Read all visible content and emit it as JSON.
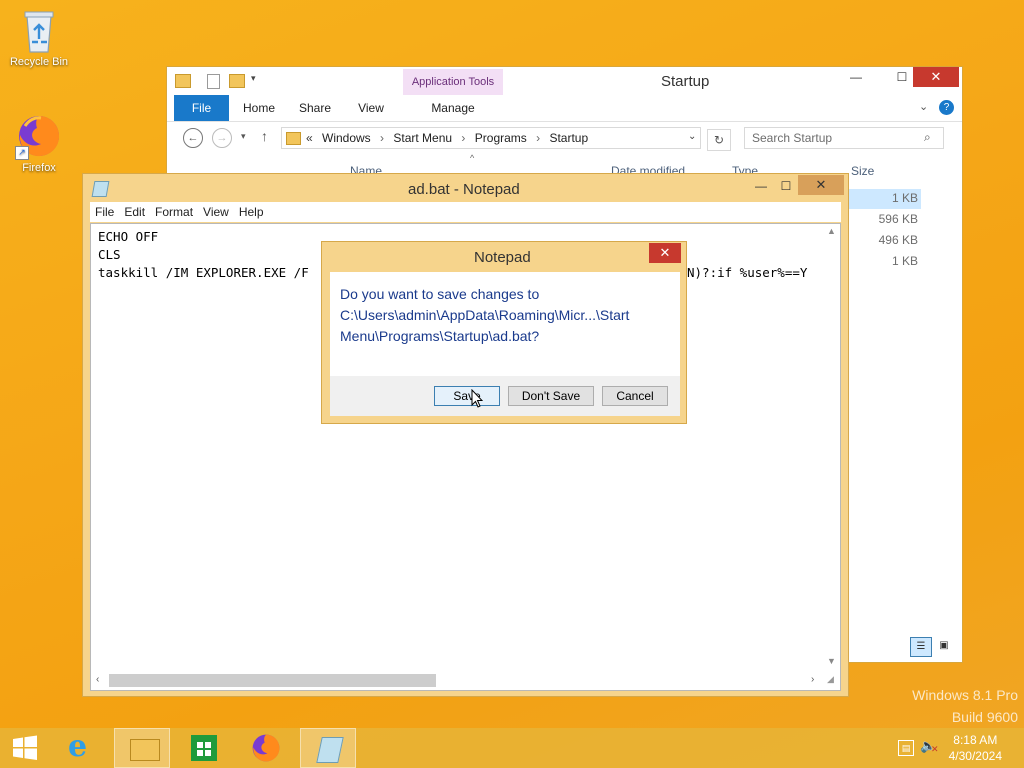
{
  "desktop": {
    "icons": [
      {
        "label": "Recycle Bin"
      },
      {
        "label": "Firefox"
      }
    ],
    "watermark_line1": "Windows 8.1 Pro",
    "watermark_line2": "Build 9600"
  },
  "explorer": {
    "title": "Startup",
    "context_tab": "Application Tools",
    "tabs": [
      "File",
      "Home",
      "Share",
      "View",
      "Manage"
    ],
    "breadcrumb_prefix": "«",
    "breadcrumb": [
      "Windows",
      "Start Menu",
      "Programs",
      "Startup"
    ],
    "search_placeholder": "Search Startup",
    "columns": {
      "name": "Name",
      "date": "Date modified",
      "type": "Type",
      "size": "Size"
    },
    "sizes": [
      "1 KB",
      "596 KB",
      "496 KB",
      "1 KB"
    ]
  },
  "notepad": {
    "title": "ad.bat - Notepad",
    "menu": [
      "File",
      "Edit",
      "Format",
      "View",
      "Help"
    ],
    "lines": [
      "ECHO OFF",
      "CLS",
      "taskkill /IM EXPLORER.EXE /F",
      "N)?:if %user%==Y"
    ]
  },
  "dialog": {
    "title": "Notepad",
    "message": "Do you want to save changes to C:\\Users\\admin\\AppData\\Roaming\\Micr...\\Start Menu\\Programs\\Startup\\ad.bat?",
    "buttons": {
      "save": "Save",
      "dont_save": "Don't Save",
      "cancel": "Cancel"
    }
  },
  "taskbar": {
    "time": "8:18 AM",
    "date": "4/30/2024"
  },
  "colors": {
    "accent_blue": "#1979ca",
    "close_red": "#c7392e",
    "desktop": "#f5a617",
    "dialog_text": "#1a3a8c"
  }
}
